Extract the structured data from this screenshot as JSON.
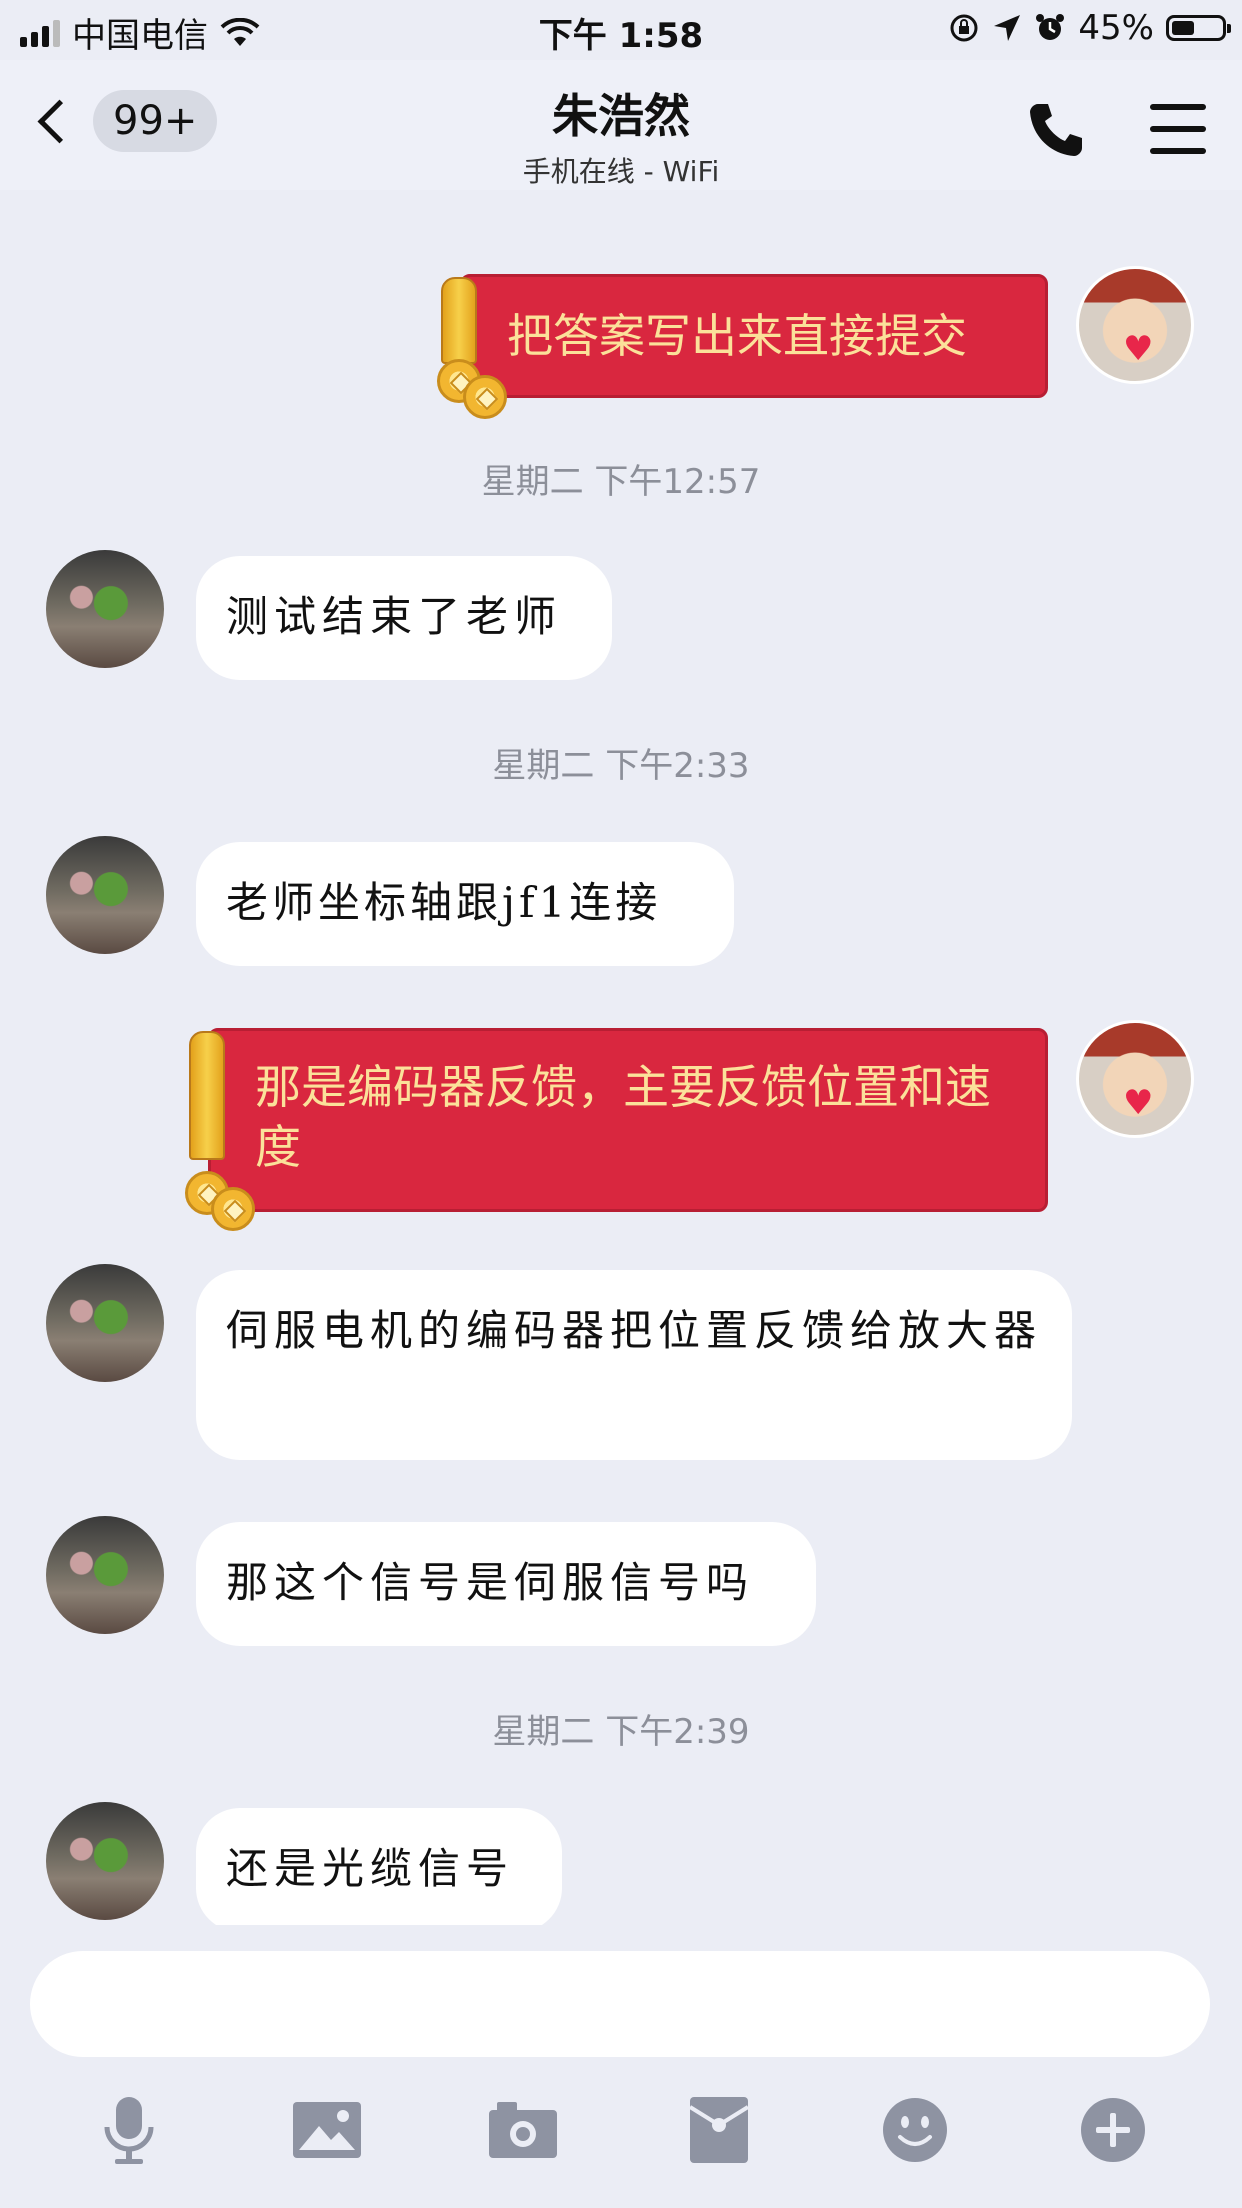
{
  "status_bar": {
    "carrier": "中国电信",
    "time": "下午 1:58",
    "battery_percent": "45%",
    "battery_level": 0.45
  },
  "header": {
    "back_badge": "99+",
    "title": "朱浩然",
    "subtitle": "手机在线 - WiFi"
  },
  "messages": [
    {
      "type": "red_packet",
      "side": "right",
      "text": "把答案写出来直接提交"
    },
    {
      "type": "timestamp",
      "text": "星期二 下午12:57"
    },
    {
      "type": "text",
      "side": "left",
      "text": "测试结束了老师"
    },
    {
      "type": "timestamp",
      "text": "星期二 下午2:33"
    },
    {
      "type": "text",
      "side": "left",
      "text": "老师坐标轴跟jf1连接"
    },
    {
      "type": "red_packet",
      "side": "right",
      "text": "那是编码器反馈，主要反馈位置和速度"
    },
    {
      "type": "text",
      "side": "left",
      "text": "伺服电机的编码器把位置反馈给放大器"
    },
    {
      "type": "text",
      "side": "left",
      "text": "那这个信号是伺服信号吗"
    },
    {
      "type": "timestamp",
      "text": "星期二 下午2:39"
    },
    {
      "type": "text",
      "side": "left",
      "text": "还是光缆信号"
    }
  ],
  "input": {
    "value": "",
    "placeholder": ""
  },
  "toolbar": [
    "mic-icon",
    "image-icon",
    "camera-icon",
    "red-packet-icon",
    "emoji-icon",
    "plus-icon"
  ],
  "colors": {
    "background": "#ebedf5",
    "red_packet": "#d9273f",
    "red_packet_text": "#fbe19a",
    "icon_gray": "#8e93a2"
  }
}
